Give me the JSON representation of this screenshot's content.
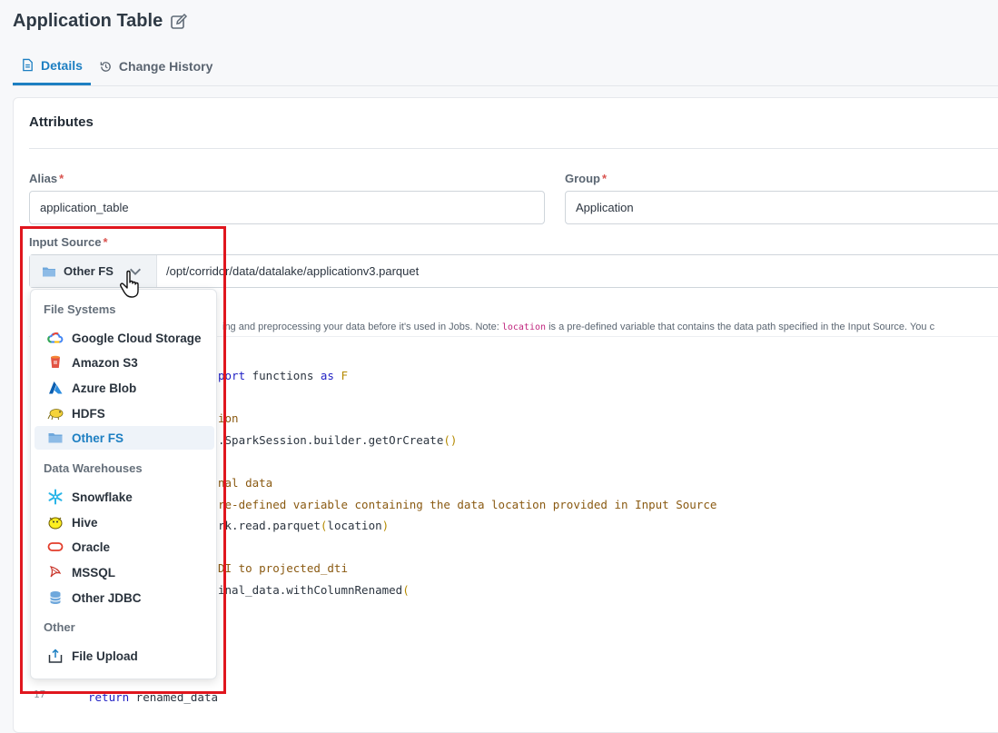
{
  "page": {
    "title": "Application Table"
  },
  "tabs": [
    {
      "label": "Details",
      "active": true
    },
    {
      "label": "Change History",
      "active": false
    }
  ],
  "card": {
    "title": "Attributes"
  },
  "fields": {
    "alias": {
      "label": "Alias",
      "required": "*",
      "value": "application_table"
    },
    "group": {
      "label": "Group",
      "required": "*",
      "value": "Application"
    },
    "input_source": {
      "label": "Input Source",
      "required": "*",
      "selected": "Other FS",
      "path": "/opt/corridor/data/datalake/applicationv3.parquet"
    }
  },
  "helper": {
    "text_before": "ing and preprocessing your data before it's used in Jobs. Note: ",
    "code": "location",
    "text_after": " is a pre-defined variable that contains the data path specified in the Input Source. You c"
  },
  "code_lines": [
    {
      "kw": "port",
      "text": " functions ",
      "kw2": "as",
      "tail": " F"
    },
    {
      "comment": "ion"
    },
    {
      "text": ".SparkSession.builder.getOrCreate",
      "paren": "()"
    },
    {
      "comment": "nal data"
    },
    {
      "comment": "re-defined variable containing the data location provided in Input Source"
    },
    {
      "text": "rk.read.parquet",
      "paren": "(",
      "text2": "location",
      "paren2": ")"
    },
    {
      "comment": "DI to projected_dti"
    },
    {
      "text": "inal_data.withColumnRenamed",
      "paren": "("
    },
    {
      "kw": "return",
      "text": " renamed_data"
    }
  ],
  "line_number_visible": "17",
  "dropdown": {
    "groups": [
      {
        "label": "File Systems",
        "items": [
          {
            "label": "Google Cloud Storage",
            "icon": "google-cloud-icon"
          },
          {
            "label": "Amazon S3",
            "icon": "amazon-s3-icon"
          },
          {
            "label": "Azure Blob",
            "icon": "azure-icon"
          },
          {
            "label": "HDFS",
            "icon": "hadoop-icon"
          },
          {
            "label": "Other FS",
            "icon": "folder-icon",
            "selected": true
          }
        ]
      },
      {
        "label": "Data Warehouses",
        "items": [
          {
            "label": "Snowflake",
            "icon": "snowflake-icon"
          },
          {
            "label": "Hive",
            "icon": "hive-icon"
          },
          {
            "label": "Oracle",
            "icon": "oracle-icon"
          },
          {
            "label": "MSSQL",
            "icon": "mssql-icon"
          },
          {
            "label": "Other JDBC",
            "icon": "database-icon"
          }
        ]
      },
      {
        "label": "Other",
        "items": [
          {
            "label": "File Upload",
            "icon": "upload-icon"
          }
        ]
      }
    ]
  },
  "colors": {
    "accent": "#1d7fc2",
    "required": "#d9534f",
    "highlight": "#e0161e"
  }
}
